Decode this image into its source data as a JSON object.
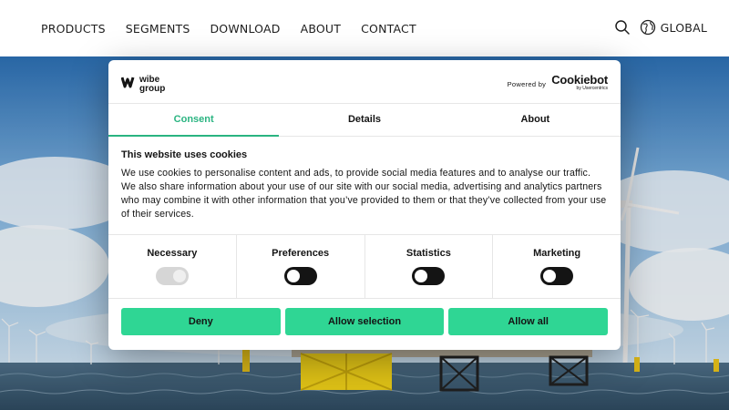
{
  "header": {
    "nav": [
      "PRODUCTS",
      "SEGMENTS",
      "DOWNLOAD",
      "ABOUT",
      "CONTACT"
    ],
    "region_label": "GLOBAL"
  },
  "dialog": {
    "brand_logo_text": "wibe group",
    "powered_by": "Powered by",
    "cookiebot_name": "Cookiebot",
    "cookiebot_sub": "by Usercentrics",
    "tabs": [
      "Consent",
      "Details",
      "About"
    ],
    "active_tab": "Consent",
    "title": "This website uses cookies",
    "description": "We use cookies to personalise content and ads, to provide social media features and to analyse our traffic. We also share information about your use of our site with our social media, advertising and analytics partners who may combine it with other information that you’ve provided to them or that they’ve collected from your use of their services.",
    "toggles": [
      {
        "label": "Necessary",
        "state": "on-disabled"
      },
      {
        "label": "Preferences",
        "state": "off"
      },
      {
        "label": "Statistics",
        "state": "off"
      },
      {
        "label": "Marketing",
        "state": "off"
      }
    ],
    "buttons": {
      "deny": "Deny",
      "allow_selection": "Allow selection",
      "allow_all": "Allow all"
    }
  },
  "colors": {
    "accent": "#2ab481",
    "button": "#2fd694",
    "toggle_off": "#141414",
    "toggle_disabled": "#d6d6d6",
    "text": "#141414"
  },
  "icons": {
    "search": "search-icon",
    "globe": "globe-icon"
  }
}
